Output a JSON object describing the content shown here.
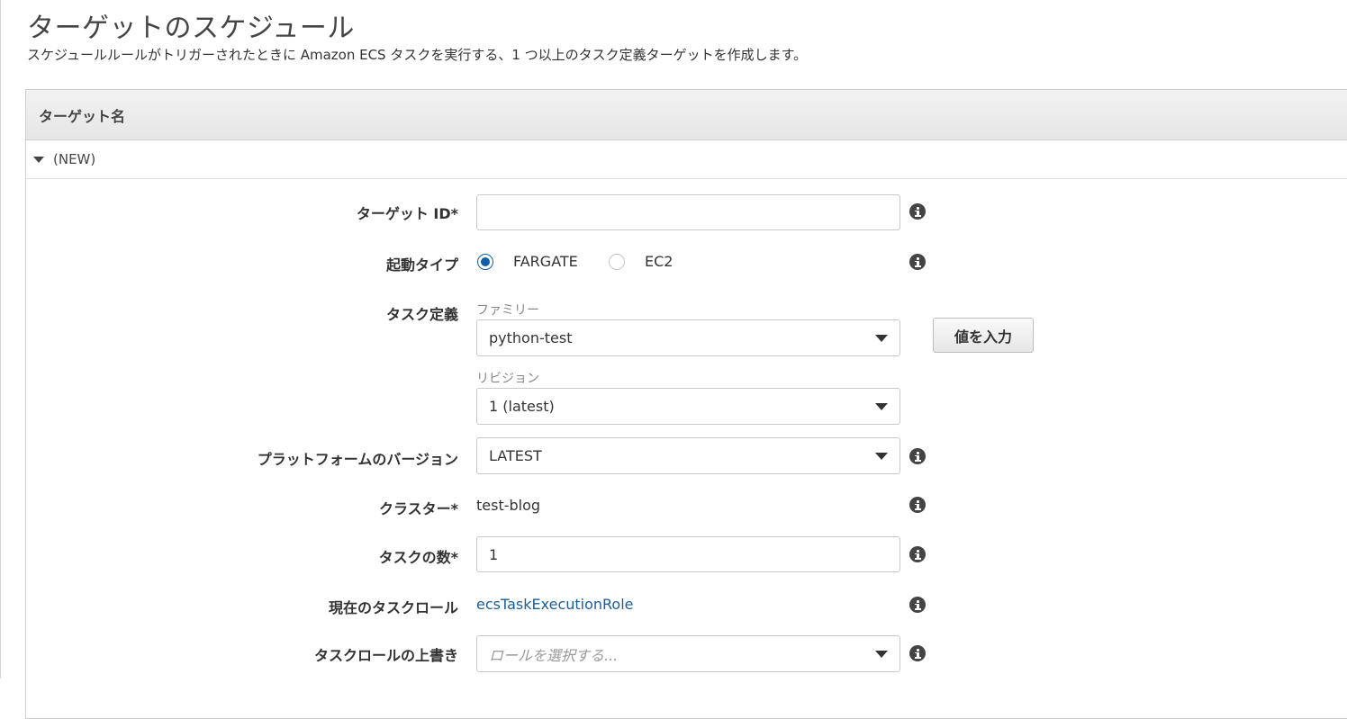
{
  "page": {
    "title": "ターゲットのスケジュール",
    "description": "スケジュールルールがトリガーされたときに Amazon ECS タスクを実行する、1 つ以上のタスク定義ターゲットを作成します。"
  },
  "panel": {
    "header": "ターゲット名",
    "target_toggle": "(NEW)"
  },
  "form": {
    "target_id": {
      "label": "ターゲット ID*",
      "value": ""
    },
    "launch_type": {
      "label": "起動タイプ",
      "options": [
        "FARGATE",
        "EC2"
      ],
      "selected": "FARGATE"
    },
    "task_definition": {
      "label": "タスク定義",
      "family_label": "ファミリー",
      "family_value": "python-test",
      "revision_label": "リビジョン",
      "revision_value": "1 (latest)",
      "enter_value_button": "値を入力"
    },
    "platform_version": {
      "label": "プラットフォームのバージョン",
      "value": "LATEST"
    },
    "cluster": {
      "label": "クラスター*",
      "value": "test-blog"
    },
    "task_count": {
      "label": "タスクの数*",
      "value": "1"
    },
    "current_task_role": {
      "label": "現在のタスクロール",
      "value": "ecsTaskExecutionRole"
    },
    "task_role_override": {
      "label": "タスクロールの上書き",
      "placeholder": "ロールを選択する..."
    }
  },
  "colors": {
    "radio_selected": "#0d5fa6",
    "link": "#1a5f97",
    "info_icon": "#444444"
  },
  "icons": {
    "info": "info-circle-icon",
    "dropdown": "caret-down-icon",
    "expand": "caret-down-icon"
  }
}
